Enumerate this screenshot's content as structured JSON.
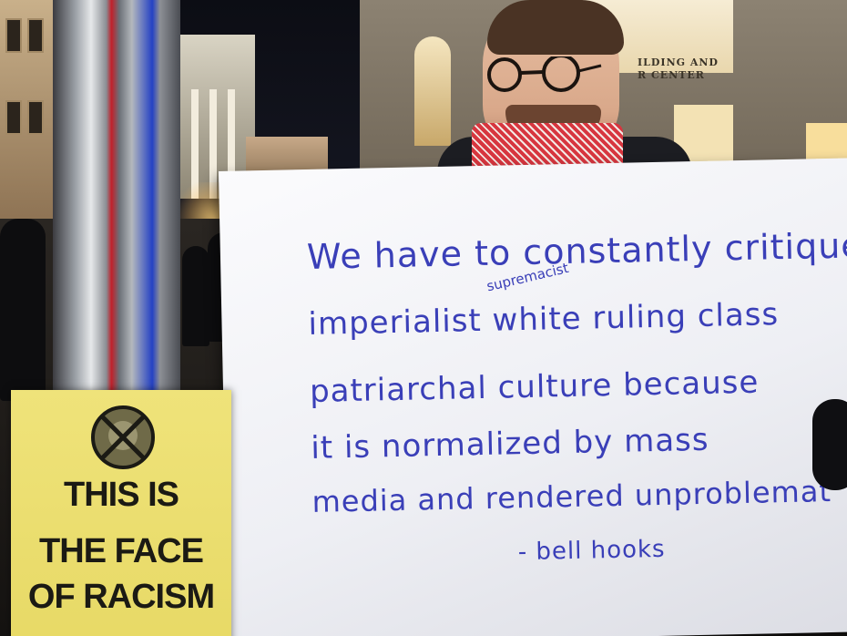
{
  "sign": {
    "lines": [
      "We have to constantly critique",
      "imperialist white ruling class",
      "patriarchal culture because",
      "it is normalized by mass",
      "media and rendered unproblemat"
    ],
    "insertion": "supremacist",
    "attribution": "- bell hooks",
    "ink_color": "#3a3fb8"
  },
  "poster": {
    "line1": "THIS IS",
    "line2": "THE FACE",
    "line3": "OF RACISM",
    "background_color": "#e9dc68",
    "icon": "crossed-out-face-icon"
  },
  "building_sign": {
    "line1": "ILDING AND",
    "line2": "R CENTER"
  },
  "scarf": {
    "colors": [
      "#d7363f",
      "#f3e9e4"
    ]
  }
}
